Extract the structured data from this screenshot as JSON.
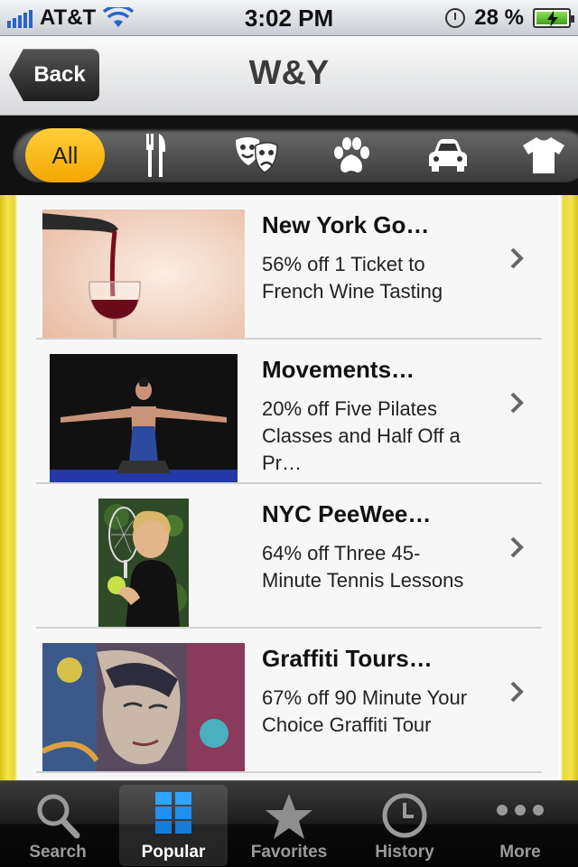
{
  "status_bar": {
    "carrier": "AT&T",
    "time": "3:02 PM",
    "battery": "28 %"
  },
  "nav": {
    "back_label": "Back",
    "title": "W&Y"
  },
  "categories": {
    "selected": "All",
    "items": [
      {
        "label": "All"
      },
      {
        "icon": "fork-knife-icon"
      },
      {
        "icon": "theater-masks-icon"
      },
      {
        "icon": "paw-icon"
      },
      {
        "icon": "car-icon"
      },
      {
        "icon": "tshirt-icon"
      }
    ]
  },
  "deals": [
    {
      "title": "New York Go…",
      "description": "56% off 1 Ticket to French Wine Tasting",
      "image": "wine-pour-photo"
    },
    {
      "title": "Movements…",
      "description": "20% off Five Pilates Classes and Half Off a Pr…",
      "image": "pilates-photo"
    },
    {
      "title": "NYC PeeWee…",
      "description": "64% off Three 45-Minute Tennis Lessons",
      "image": "tennis-girl-photo"
    },
    {
      "title": "Graffiti Tours…",
      "description": "67% off 90 Minute Your Choice Graffiti Tour",
      "image": "graffiti-photo"
    }
  ],
  "tabs": [
    {
      "label": "Search",
      "icon": "magnifier-icon"
    },
    {
      "label": "Popular",
      "icon": "grid-icon",
      "active": true
    },
    {
      "label": "Favorites",
      "icon": "star-icon"
    },
    {
      "label": "History",
      "icon": "clock-icon"
    },
    {
      "label": "More",
      "icon": "more-dots-icon"
    }
  ],
  "colors": {
    "accent": "#f5a700",
    "side_yellow": "#e9d73b"
  }
}
